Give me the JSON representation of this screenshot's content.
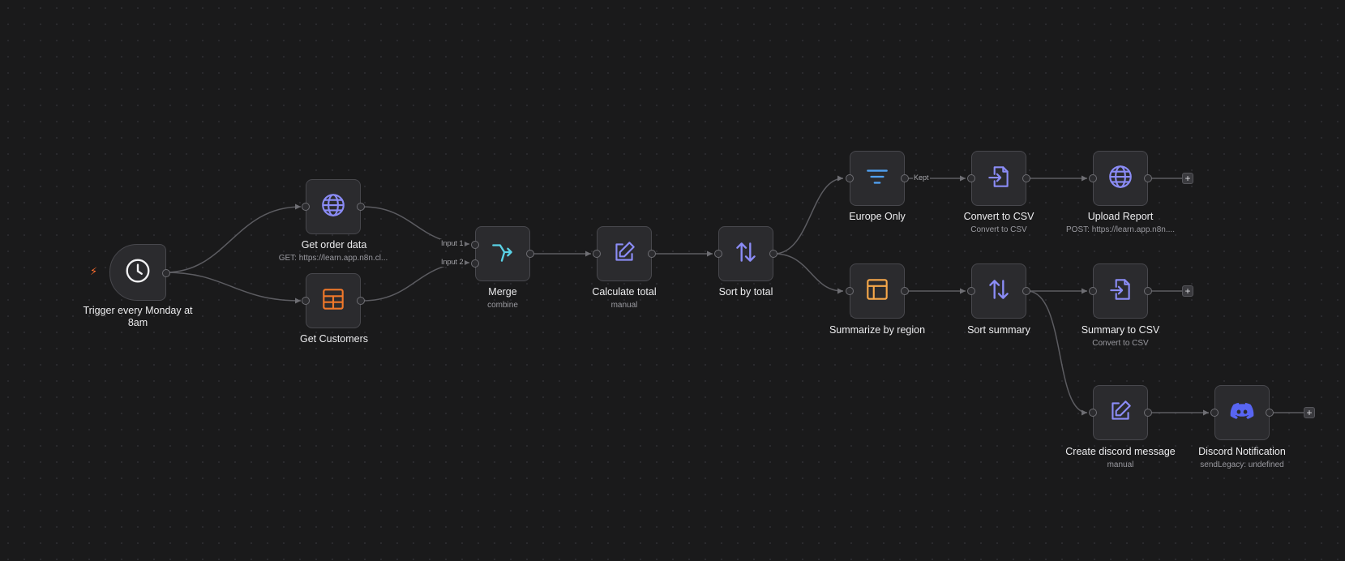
{
  "colors": {
    "background": "#1a1a1b",
    "node_fill": "#2b2b2e",
    "edge": "#5c5c61",
    "purple_icon": "#8b8cf6",
    "orange_icon": "#f0782a",
    "cyan_icon": "#5ad2e6",
    "blue_icon": "#50a0f0",
    "amber_icon": "#f7a84a",
    "discord": "#5865f2",
    "trigger_bolt": "#ff6d2d"
  },
  "nodes": {
    "trigger": {
      "label": "Trigger every Monday at 8am",
      "icon": "clock-icon"
    },
    "get_order_data": {
      "label": "Get order data",
      "subtitle": "GET: https://learn.app.n8n.cl...",
      "icon": "globe-icon"
    },
    "get_customers": {
      "label": "Get Customers",
      "icon": "table-icon"
    },
    "merge": {
      "label": "Merge",
      "subtitle": "combine",
      "icon": "merge-icon",
      "inputs": [
        "Input 1",
        "Input 2"
      ]
    },
    "calculate_total": {
      "label": "Calculate total",
      "subtitle": "manual",
      "icon": "edit-icon"
    },
    "sort_by_total": {
      "label": "Sort by total",
      "icon": "sort-icon"
    },
    "europe_only": {
      "label": "Europe Only",
      "icon": "filter-icon",
      "output_label": "Kept"
    },
    "convert_to_csv": {
      "label": "Convert to CSV",
      "subtitle": "Convert to CSV",
      "icon": "file-export-icon"
    },
    "upload_report": {
      "label": "Upload Report",
      "subtitle": "POST: https://learn.app.n8n....",
      "icon": "globe-icon"
    },
    "summarize_by_region": {
      "label": "Summarize by region",
      "icon": "summarize-icon"
    },
    "sort_summary": {
      "label": "Sort summary",
      "icon": "sort-icon"
    },
    "summary_to_csv": {
      "label": "Summary to CSV",
      "subtitle": "Convert to CSV",
      "icon": "file-export-icon"
    },
    "create_discord_message": {
      "label": "Create discord message",
      "subtitle": "manual",
      "icon": "edit-icon"
    },
    "discord_notification": {
      "label": "Discord Notification",
      "subtitle": "sendLegacy: undefined",
      "icon": "discord-icon"
    }
  },
  "add_button_label": "+"
}
